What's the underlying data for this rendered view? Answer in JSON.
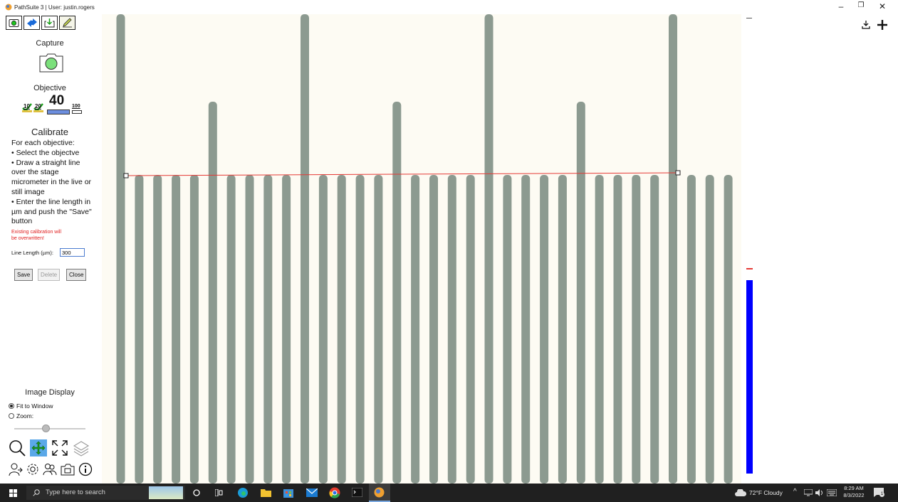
{
  "window": {
    "title": "PathSuite 3 | User: justin.rogers",
    "controls": [
      "–",
      "❐",
      "✕"
    ]
  },
  "toolbar": {
    "icons": [
      "capture-mode-icon",
      "arrows-icon",
      "download-icon",
      "pencil-icon"
    ]
  },
  "capture": {
    "title": "Capture"
  },
  "objective": {
    "title": "Objective",
    "options": [
      "10",
      "20",
      "40",
      "100"
    ],
    "selected": "40"
  },
  "calibrate": {
    "title": "Calibrate",
    "instructions": [
      "For each objective:",
      "• Select the objectve",
      "• Draw a straight line over the stage micrometer in the live or still image",
      "• Enter the line length in µm and push the \"Save\" button"
    ],
    "warning_line1": "Existing calibration will",
    "warning_line2": "be overwritten!",
    "line_length_label": "Line Length (µm):",
    "line_length_value": "300",
    "save_label": "Save",
    "delete_label": "Delete",
    "close_label": "Close"
  },
  "image_display": {
    "title": "Image Display",
    "fit_label": "Fit to Window",
    "zoom_label": "Zoom:",
    "fit_selected": true,
    "zoom_slider_fraction": 0.4
  },
  "viewer": {
    "measurement_line_color": "#e53935",
    "ruler_level_fraction": 0.72
  },
  "taskbar": {
    "search_placeholder": "Type here to search",
    "weather": "72°F  Cloudy",
    "time": "8:29 AM",
    "date": "8/3/2022",
    "notification_count": "1"
  },
  "colors": {
    "accent_blue": "#0000ff",
    "line_red": "#e53935",
    "stripe": "#8c9a90",
    "warn_red": "#e02020"
  }
}
